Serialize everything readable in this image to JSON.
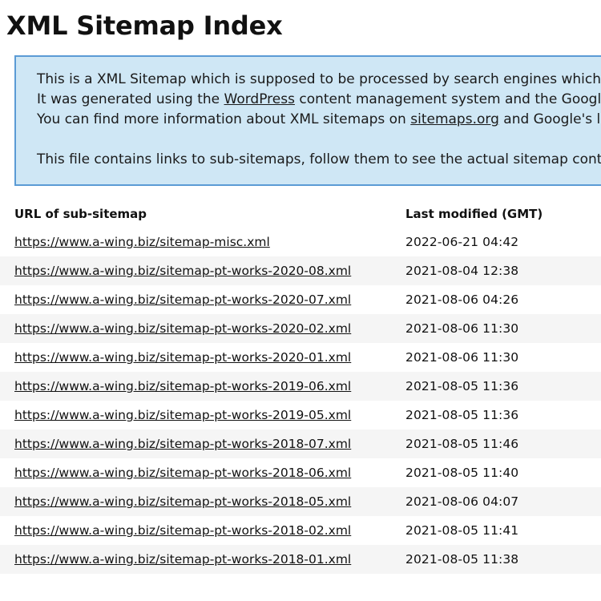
{
  "page": {
    "title": "XML Sitemap Index"
  },
  "info_box": {
    "paragraph1_part1": "This is a XML Sitemap which is supposed to be processed by search engines which follow the XML Sitemap standard like Ask.com, Bing, Google and Yahoo.",
    "paragraph1_part2_pre": "It was generated using the ",
    "paragraph1_link1": "WordPress",
    "paragraph1_part2_post": " content management system and the Google Sitemap Generator Plugin by Arne Brachhold.",
    "paragraph1_part3_pre": "You can find more information about XML sitemaps on ",
    "paragraph1_link2": "sitemaps.org",
    "paragraph1_part3_post": " and Google's list of sitemap programs.",
    "paragraph2": "This file contains links to sub-sitemaps, follow them to see the actual sitemap content."
  },
  "table": {
    "headers": {
      "url": "URL of sub-sitemap",
      "last_modified": "Last modified (GMT)"
    },
    "rows": [
      {
        "url": "https://www.a-wing.biz/sitemap-misc.xml",
        "modified": "2022-06-21 04:42"
      },
      {
        "url": "https://www.a-wing.biz/sitemap-pt-works-2020-08.xml",
        "modified": "2021-08-04 12:38"
      },
      {
        "url": "https://www.a-wing.biz/sitemap-pt-works-2020-07.xml",
        "modified": "2021-08-06 04:26"
      },
      {
        "url": "https://www.a-wing.biz/sitemap-pt-works-2020-02.xml",
        "modified": "2021-08-06 11:30"
      },
      {
        "url": "https://www.a-wing.biz/sitemap-pt-works-2020-01.xml",
        "modified": "2021-08-06 11:30"
      },
      {
        "url": "https://www.a-wing.biz/sitemap-pt-works-2019-06.xml",
        "modified": "2021-08-05 11:36"
      },
      {
        "url": "https://www.a-wing.biz/sitemap-pt-works-2019-05.xml",
        "modified": "2021-08-05 11:36"
      },
      {
        "url": "https://www.a-wing.biz/sitemap-pt-works-2018-07.xml",
        "modified": "2021-08-05 11:46"
      },
      {
        "url": "https://www.a-wing.biz/sitemap-pt-works-2018-06.xml",
        "modified": "2021-08-05 11:40"
      },
      {
        "url": "https://www.a-wing.biz/sitemap-pt-works-2018-05.xml",
        "modified": "2021-08-06 04:07"
      },
      {
        "url": "https://www.a-wing.biz/sitemap-pt-works-2018-02.xml",
        "modified": "2021-08-05 11:41"
      },
      {
        "url": "https://www.a-wing.biz/sitemap-pt-works-2018-01.xml",
        "modified": "2021-08-05 11:38"
      }
    ]
  },
  "colors": {
    "info_box_background": "#cfe7f5",
    "info_box_border": "#5b9bd5",
    "row_stripe": "#f5f5f5",
    "text": "#111111",
    "page_background": "#ffffff"
  }
}
